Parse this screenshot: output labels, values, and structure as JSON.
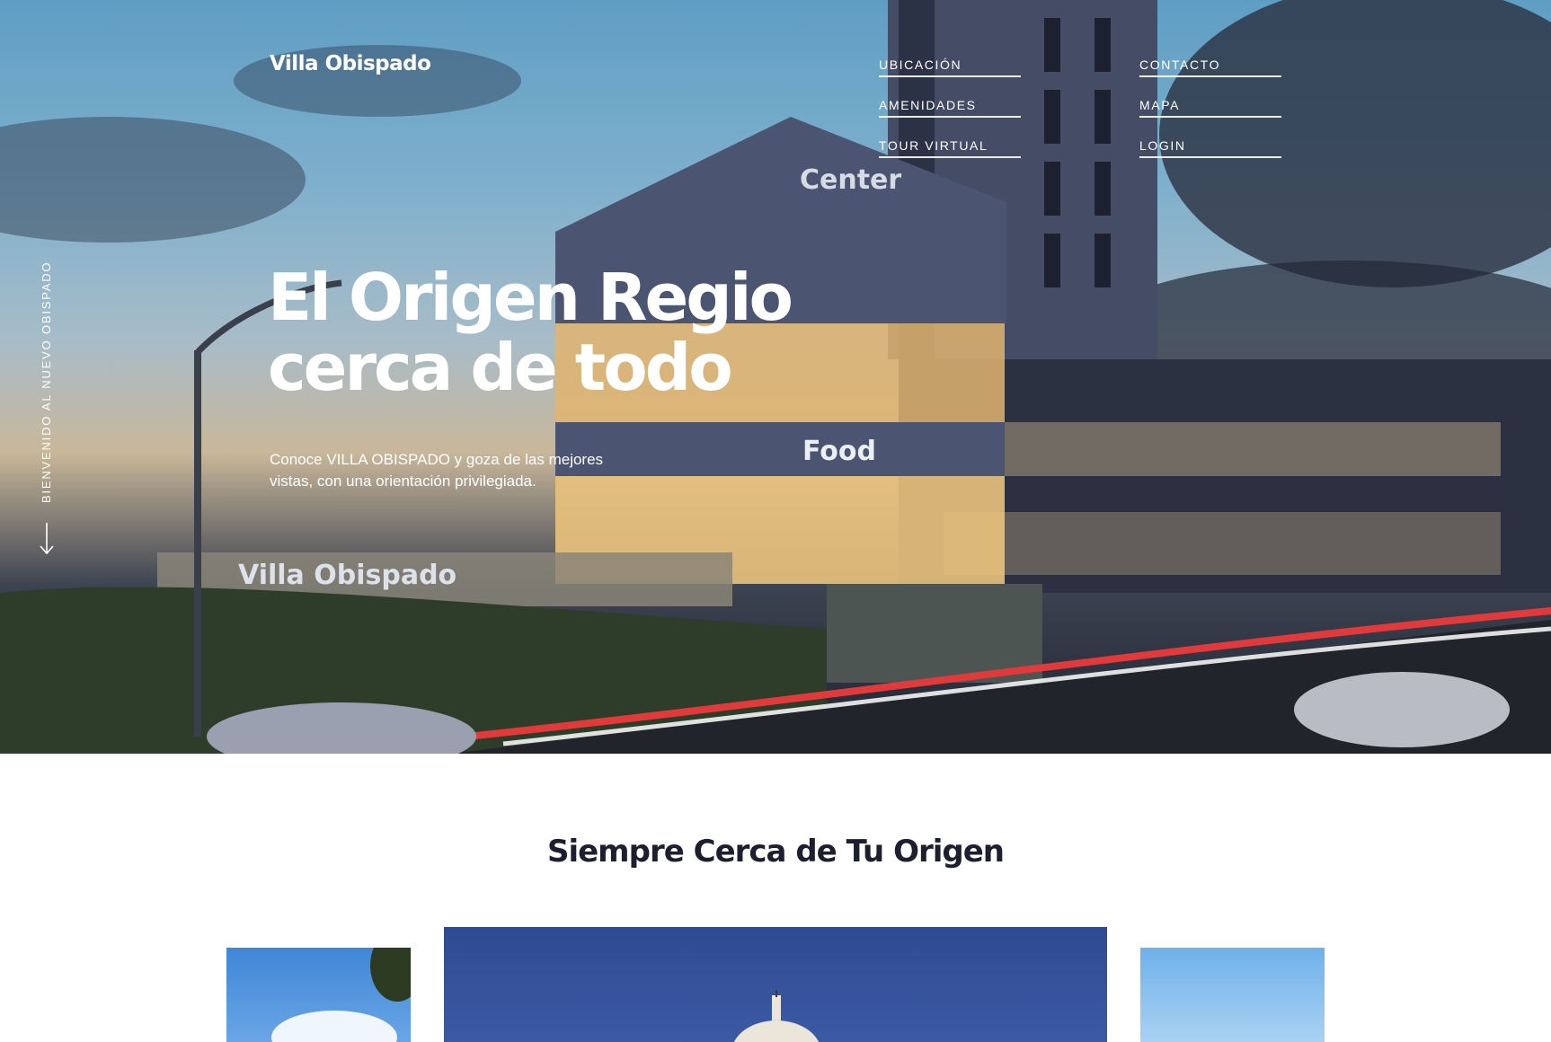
{
  "brand": {
    "logo_text": "Villa Obispado"
  },
  "nav": {
    "column1": [
      {
        "label": "UBICACIÓN"
      },
      {
        "label": "AMENIDADES"
      },
      {
        "label": "TOUR VIRTUAL"
      }
    ],
    "column2": [
      {
        "label": "CONTACTO"
      },
      {
        "label": "MAPA"
      },
      {
        "label": "LOGIN"
      }
    ]
  },
  "hero": {
    "side_text": "BIENVENIDO AL NUEVO OBISPADO",
    "headline_line1": "El Origen Regio",
    "headline_line2": "cerca de todo",
    "subtext": "Conoce VILLA OBISPADO y goza de las mejores vistas, con una orientación privilegiada.",
    "scene_signs": [
      "Center",
      "Food",
      "Villa Obispado"
    ],
    "scroll_icon": "arrow-down-icon"
  },
  "section": {
    "title": "Siempre Cerca de Tu Origen"
  },
  "colors": {
    "text_dark": "#1d1f2e",
    "white": "#ffffff",
    "building": "#4b5470"
  }
}
